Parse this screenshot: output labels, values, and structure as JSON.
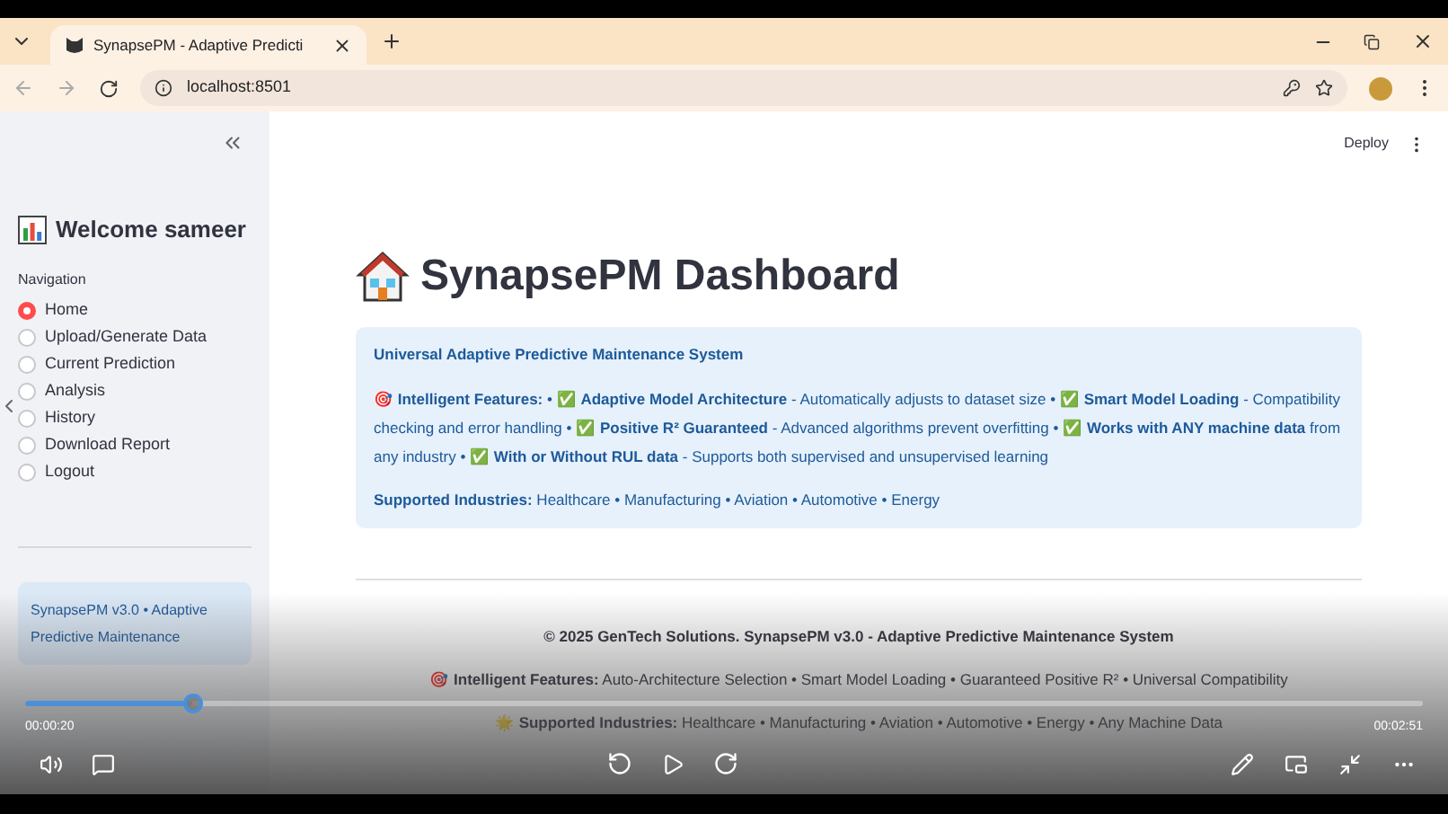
{
  "browser": {
    "tab": {
      "title": "SynapsePM - Adaptive Predicti",
      "selected": true
    },
    "address": "localhost:8501"
  },
  "app_header": {
    "deploy": "Deploy"
  },
  "sidebar": {
    "welcome": "Welcome sameer",
    "nav_label": "Navigation",
    "items": [
      {
        "label": "Home",
        "selected": true
      },
      {
        "label": "Upload/Generate Data",
        "selected": false
      },
      {
        "label": "Current Prediction",
        "selected": false
      },
      {
        "label": "Analysis",
        "selected": false
      },
      {
        "label": "History",
        "selected": false
      },
      {
        "label": "Download Report",
        "selected": false
      },
      {
        "label": "Logout",
        "selected": false
      }
    ],
    "info": "SynapsePM v3.0 • Adaptive Predictive Maintenance"
  },
  "main": {
    "title": "SynapsePM Dashboard",
    "info_box": {
      "heading": "Universal Adaptive Predictive Maintenance System",
      "features": "🎯 **Intelligent Features:** • ✅ **Adaptive Model Architecture** - Automatically adjusts to dataset size • ✅ **Smart Model Loading** - Compatibility checking and error handling • ✅ **Positive R² Guaranteed** - Advanced algorithms prevent overfitting • ✅ **Works with ANY machine data** from any industry • ✅ **With or Without RUL data** - Supports both supervised and unsupervised learning",
      "industries": "**Supported Industries:** Healthcare • Manufacturing • Aviation • Automotive • Energy"
    }
  },
  "footer": {
    "copyright": "© 2025 GenTech Solutions. SynapsePM v3.0 - Adaptive Predictive Maintenance System",
    "features": "🎯 **Intelligent Features:** Auto-Architecture Selection • Smart Model Loading • Guaranteed Positive R² • Universal Compatibility",
    "industries": "🌟 **Supported Industries:** Healthcare • Manufacturing • Aviation • Automotive • Energy • Any Machine Data"
  },
  "video": {
    "level": 0.12,
    "elapsed": "00:00:20",
    "duration": "00:02:51"
  }
}
